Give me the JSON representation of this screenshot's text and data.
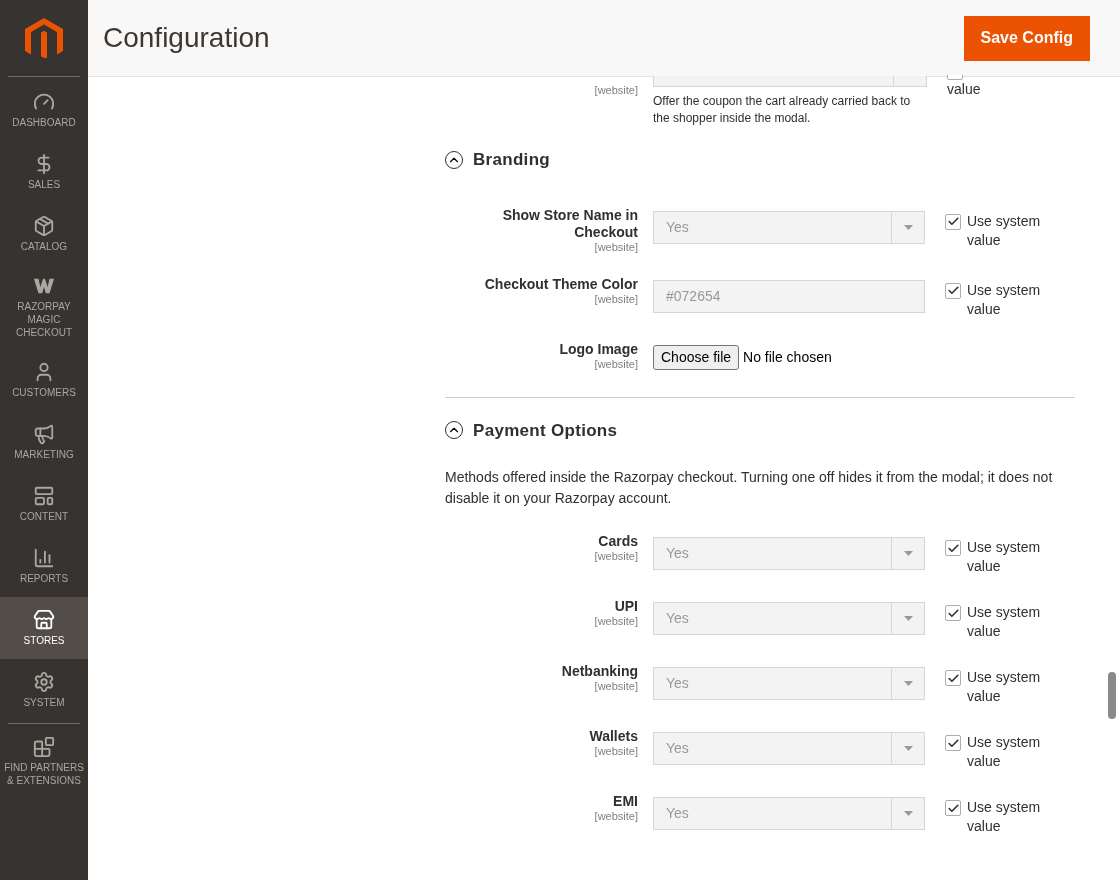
{
  "sidebar": {
    "items": [
      {
        "label": "DASHBOARD",
        "selected": false
      },
      {
        "label": "SALES",
        "selected": false
      },
      {
        "label": "CATALOG",
        "selected": false
      },
      {
        "label": "RAZORPAY MAGIC CHECKOUT",
        "selected": false
      },
      {
        "label": "CUSTOMERS",
        "selected": false
      },
      {
        "label": "MARKETING",
        "selected": false
      },
      {
        "label": "CONTENT",
        "selected": false
      },
      {
        "label": "REPORTS",
        "selected": false
      },
      {
        "label": "STORES",
        "selected": true
      },
      {
        "label": "SYSTEM",
        "selected": false
      },
      {
        "label": "FIND PARTNERS & EXTENSIONS",
        "selected": false
      }
    ]
  },
  "header": {
    "title": "Configuration",
    "save_button": "Save Config"
  },
  "partial_row": {
    "scope": "[website]",
    "note": "Offer the coupon the cart already carried back to the shopper inside the modal.",
    "use_default": {
      "label": "value",
      "checked": false
    }
  },
  "sections": [
    {
      "title": "Branding",
      "expanded": true,
      "fields": [
        {
          "kind": "select",
          "label": "Show Store Name in Checkout",
          "scope": "[website]",
          "value": "Yes",
          "use_default": {
            "label": "Use system value",
            "checked": true
          }
        },
        {
          "kind": "text",
          "label": "Checkout Theme Color",
          "scope": "[website]",
          "value": "#072654",
          "use_default": {
            "label": "Use system value",
            "checked": true
          }
        },
        {
          "kind": "file",
          "label": "Logo Image",
          "scope": "[website]",
          "button": "Choose file",
          "value": "No file chosen"
        }
      ]
    },
    {
      "title": "Payment Options",
      "expanded": true,
      "description": "Methods offered inside the Razorpay checkout. Turning one off hides it from the modal; it does not disable it on your Razorpay account.",
      "fields": [
        {
          "kind": "select",
          "label": "Cards",
          "scope": "[website]",
          "value": "Yes",
          "use_default": {
            "label": "Use system value",
            "checked": true
          }
        },
        {
          "kind": "select",
          "label": "UPI",
          "scope": "[website]",
          "value": "Yes",
          "use_default": {
            "label": "Use system value",
            "checked": true
          }
        },
        {
          "kind": "select",
          "label": "Netbanking",
          "scope": "[website]",
          "value": "Yes",
          "use_default": {
            "label": "Use system value",
            "checked": true
          }
        },
        {
          "kind": "select",
          "label": "Wallets",
          "scope": "[website]",
          "value": "Yes",
          "use_default": {
            "label": "Use system value",
            "checked": true
          }
        },
        {
          "kind": "select",
          "label": "EMI",
          "scope": "[website]",
          "value": "Yes",
          "use_default": {
            "label": "Use system value",
            "checked": true
          }
        }
      ]
    }
  ]
}
